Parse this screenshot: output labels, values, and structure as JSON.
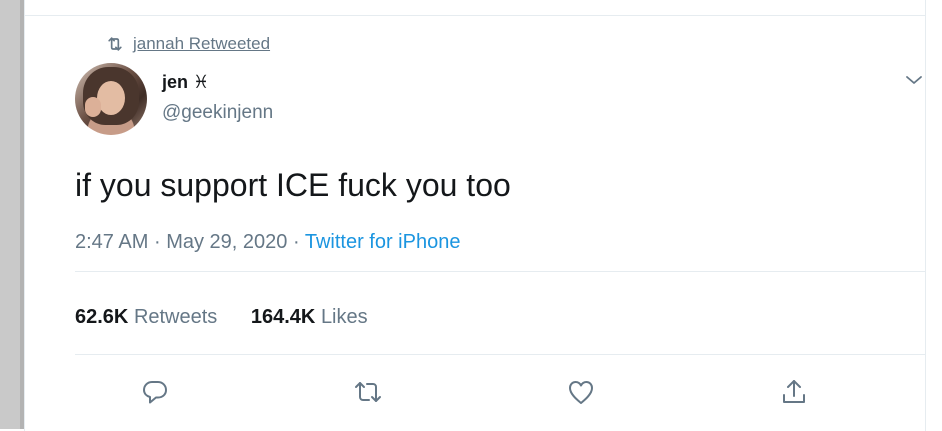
{
  "retweet_context": {
    "text": "jannah Retweeted",
    "icon": "retweet-icon"
  },
  "tweet": {
    "author_name": "jen ♓",
    "author_handle": "@geekinjenn",
    "text": "if you support ICE fuck you too",
    "time": "2:47 AM",
    "separator": "·",
    "date": "May 29, 2020",
    "source": "Twitter for iPhone",
    "menu_icon": "chevron-down-icon"
  },
  "stats": {
    "retweets_count": "62.6K",
    "retweets_label": "Retweets",
    "likes_count": "164.4K",
    "likes_label": "Likes"
  },
  "actions": [
    {
      "name": "reply",
      "icon": "reply-icon"
    },
    {
      "name": "retweet",
      "icon": "retweet-icon"
    },
    {
      "name": "like",
      "icon": "heart-icon"
    },
    {
      "name": "share",
      "icon": "share-icon"
    }
  ],
  "colors": {
    "secondary_text": "#657786",
    "link_blue": "#1b95e0",
    "divider": "#e6ecf0",
    "primary_text": "#14171a"
  }
}
